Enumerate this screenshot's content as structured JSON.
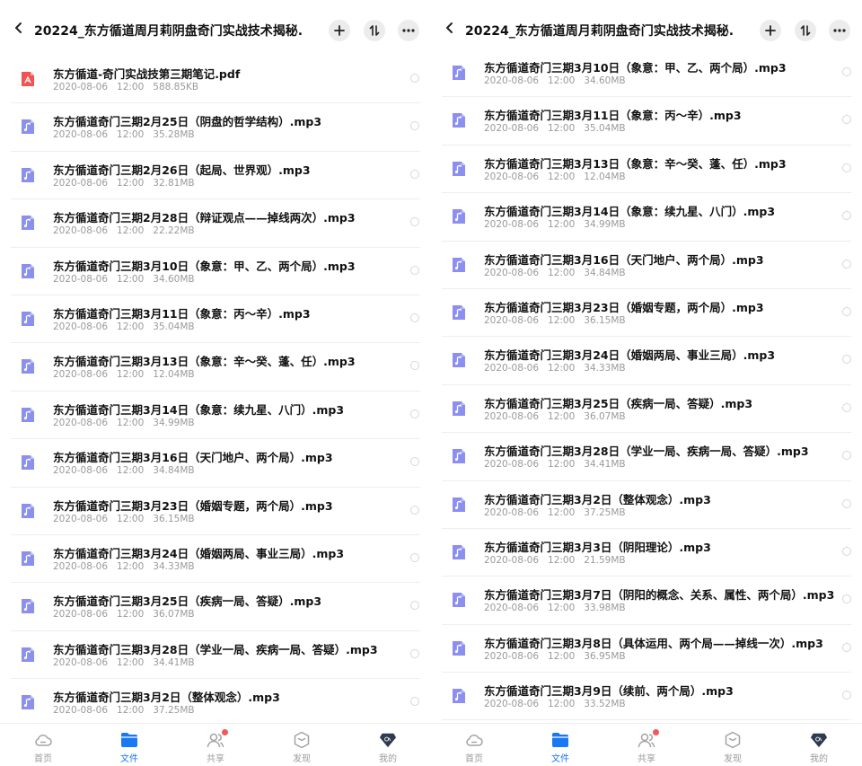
{
  "colors": {
    "accent": "#1a78f2",
    "audio_icon": "#8b8fef",
    "pdf_icon": "#f25252",
    "badge": "#f2575b"
  },
  "panes": [
    {
      "header": {
        "title": "20224_东方循道周月莉阴盘奇门实战技术揭秘..."
      },
      "files": [
        {
          "type": "pdf",
          "name": "东方循道-奇门实战技第三期笔记.pdf",
          "date": "2020-08-06",
          "time": "12:00",
          "size": "588.85KB"
        },
        {
          "type": "audio",
          "name": "东方循道奇门三期2月25日（阴盘的哲学结构）.mp3",
          "date": "2020-08-06",
          "time": "12:00",
          "size": "35.28MB"
        },
        {
          "type": "audio",
          "name": "东方循道奇门三期2月26日（起局、世界观）.mp3",
          "date": "2020-08-06",
          "time": "12:00",
          "size": "32.81MB"
        },
        {
          "type": "audio",
          "name": "东方循道奇门三期2月28日（辩证观点——掉线两次）.mp3",
          "date": "2020-08-06",
          "time": "12:00",
          "size": "22.22MB"
        },
        {
          "type": "audio",
          "name": "东方循道奇门三期3月10日（象意：甲、乙、两个局）.mp3",
          "date": "2020-08-06",
          "time": "12:00",
          "size": "34.60MB"
        },
        {
          "type": "audio",
          "name": "东方循道奇门三期3月11日（象意：丙～辛）.mp3",
          "date": "2020-08-06",
          "time": "12:00",
          "size": "35.04MB"
        },
        {
          "type": "audio",
          "name": "东方循道奇门三期3月13日（象意：辛～癸、蓬、任）.mp3",
          "date": "2020-08-06",
          "time": "12:00",
          "size": "12.04MB"
        },
        {
          "type": "audio",
          "name": "东方循道奇门三期3月14日（象意：续九星、八门）.mp3",
          "date": "2020-08-06",
          "time": "12:00",
          "size": "34.99MB"
        },
        {
          "type": "audio",
          "name": "东方循道奇门三期3月16日（天门地户、两个局）.mp3",
          "date": "2020-08-06",
          "time": "12:00",
          "size": "34.84MB"
        },
        {
          "type": "audio",
          "name": "东方循道奇门三期3月23日（婚姻专题，两个局）.mp3",
          "date": "2020-08-06",
          "time": "12:00",
          "size": "36.15MB"
        },
        {
          "type": "audio",
          "name": "东方循道奇门三期3月24日（婚姻两局、事业三局）.mp3",
          "date": "2020-08-06",
          "time": "12:00",
          "size": "34.33MB"
        },
        {
          "type": "audio",
          "name": "东方循道奇门三期3月25日（疾病一局、答疑）.mp3",
          "date": "2020-08-06",
          "time": "12:00",
          "size": "36.07MB"
        },
        {
          "type": "audio",
          "name": "东方循道奇门三期3月28日（学业一局、疾病一局、答疑）.mp3",
          "date": "2020-08-06",
          "time": "12:00",
          "size": "34.41MB"
        },
        {
          "type": "audio",
          "name": "东方循道奇门三期3月2日（整体观念）.mp3",
          "date": "2020-08-06",
          "time": "12:00",
          "size": "37.25MB"
        }
      ],
      "tabs": [
        {
          "label": "首页",
          "icon": "cloud-icon",
          "active": false
        },
        {
          "label": "文件",
          "icon": "folder-icon",
          "active": true
        },
        {
          "label": "共享",
          "icon": "share-users-icon",
          "active": false,
          "badge": true
        },
        {
          "label": "发现",
          "icon": "discover-icon",
          "active": false
        },
        {
          "label": "我的",
          "icon": "profile-diamond-icon",
          "active": false
        }
      ]
    },
    {
      "header": {
        "title": "20224_东方循道周月莉阴盘奇门实战技术揭秘..."
      },
      "files": [
        {
          "type": "audio",
          "name": "东方循道奇门三期3月10日（象意：甲、乙、两个局）.mp3",
          "date": "2020-08-06",
          "time": "12:00",
          "size": "34.60MB"
        },
        {
          "type": "audio",
          "name": "东方循道奇门三期3月11日（象意：丙～辛）.mp3",
          "date": "2020-08-06",
          "time": "12:00",
          "size": "35.04MB"
        },
        {
          "type": "audio",
          "name": "东方循道奇门三期3月13日（象意：辛～癸、蓬、任）.mp3",
          "date": "2020-08-06",
          "time": "12:00",
          "size": "12.04MB"
        },
        {
          "type": "audio",
          "name": "东方循道奇门三期3月14日（象意：续九星、八门）.mp3",
          "date": "2020-08-06",
          "time": "12:00",
          "size": "34.99MB"
        },
        {
          "type": "audio",
          "name": "东方循道奇门三期3月16日（天门地户、两个局）.mp3",
          "date": "2020-08-06",
          "time": "12:00",
          "size": "34.84MB"
        },
        {
          "type": "audio",
          "name": "东方循道奇门三期3月23日（婚姻专题，两个局）.mp3",
          "date": "2020-08-06",
          "time": "12:00",
          "size": "36.15MB"
        },
        {
          "type": "audio",
          "name": "东方循道奇门三期3月24日（婚姻两局、事业三局）.mp3",
          "date": "2020-08-06",
          "time": "12:00",
          "size": "34.33MB"
        },
        {
          "type": "audio",
          "name": "东方循道奇门三期3月25日（疾病一局、答疑）.mp3",
          "date": "2020-08-06",
          "time": "12:00",
          "size": "36.07MB"
        },
        {
          "type": "audio",
          "name": "东方循道奇门三期3月28日（学业一局、疾病一局、答疑）.mp3",
          "date": "2020-08-06",
          "time": "12:00",
          "size": "34.41MB"
        },
        {
          "type": "audio",
          "name": "东方循道奇门三期3月2日（整体观念）.mp3",
          "date": "2020-08-06",
          "time": "12:00",
          "size": "37.25MB"
        },
        {
          "type": "audio",
          "name": "东方循道奇门三期3月3日（阴阳理论）.mp3",
          "date": "2020-08-06",
          "time": "12:00",
          "size": "21.59MB"
        },
        {
          "type": "audio",
          "name": "东方循道奇门三期3月7日（阴阳的概念、关系、属性、两个局）.mp3",
          "date": "2020-08-06",
          "time": "12:00",
          "size": "33.98MB"
        },
        {
          "type": "audio",
          "name": "东方循道奇门三期3月8日（具体运用、两个局——掉线一次）.mp3",
          "date": "2020-08-06",
          "time": "12:00",
          "size": "36.95MB"
        },
        {
          "type": "audio",
          "name": "东方循道奇门三期3月9日（续前、两个局）.mp3",
          "date": "2020-08-06",
          "time": "12:00",
          "size": "33.52MB"
        }
      ],
      "tabs": [
        {
          "label": "首页",
          "icon": "cloud-icon",
          "active": false
        },
        {
          "label": "文件",
          "icon": "folder-icon",
          "active": true
        },
        {
          "label": "共享",
          "icon": "share-users-icon",
          "active": false,
          "badge": true
        },
        {
          "label": "发现",
          "icon": "discover-icon",
          "active": false
        },
        {
          "label": "我的",
          "icon": "profile-diamond-icon",
          "active": false
        }
      ]
    }
  ]
}
